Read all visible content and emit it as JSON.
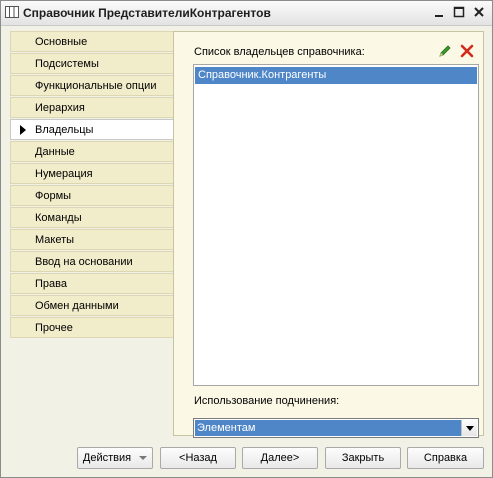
{
  "window": {
    "title": "Справочник ПредставителиКонтрагентов"
  },
  "nav": {
    "items": [
      {
        "label": "Основные"
      },
      {
        "label": "Подсистемы"
      },
      {
        "label": "Функциональные опции"
      },
      {
        "label": "Иерархия"
      },
      {
        "label": "Владельцы",
        "active": true
      },
      {
        "label": "Данные"
      },
      {
        "label": "Нумерация"
      },
      {
        "label": "Формы"
      },
      {
        "label": "Команды"
      },
      {
        "label": "Макеты"
      },
      {
        "label": "Ввод на основании"
      },
      {
        "label": "Права"
      },
      {
        "label": "Обмен данными"
      },
      {
        "label": "Прочее"
      }
    ]
  },
  "owners": {
    "label": "Список владельцев справочника:",
    "items": [
      "Справочник.Контрагенты"
    ]
  },
  "subordination": {
    "label": "Использование подчинения:",
    "value": "Элементам"
  },
  "buttons": {
    "actions": "Действия",
    "back": "<Назад",
    "next": "Далее>",
    "close": "Закрыть",
    "help": "Справка"
  },
  "colors": {
    "selection": "#4f86c8",
    "nav_background": "#f1ecca",
    "panel_background": "#fbf8e6",
    "edit_icon": "#3a9a2a",
    "delete_icon": "#d42a1a"
  },
  "icons": [
    "table-icon",
    "minimize-icon",
    "maximize-icon",
    "close-icon",
    "pencil-icon",
    "delete-icon",
    "triangle-right-icon",
    "chevron-down-icon"
  ]
}
